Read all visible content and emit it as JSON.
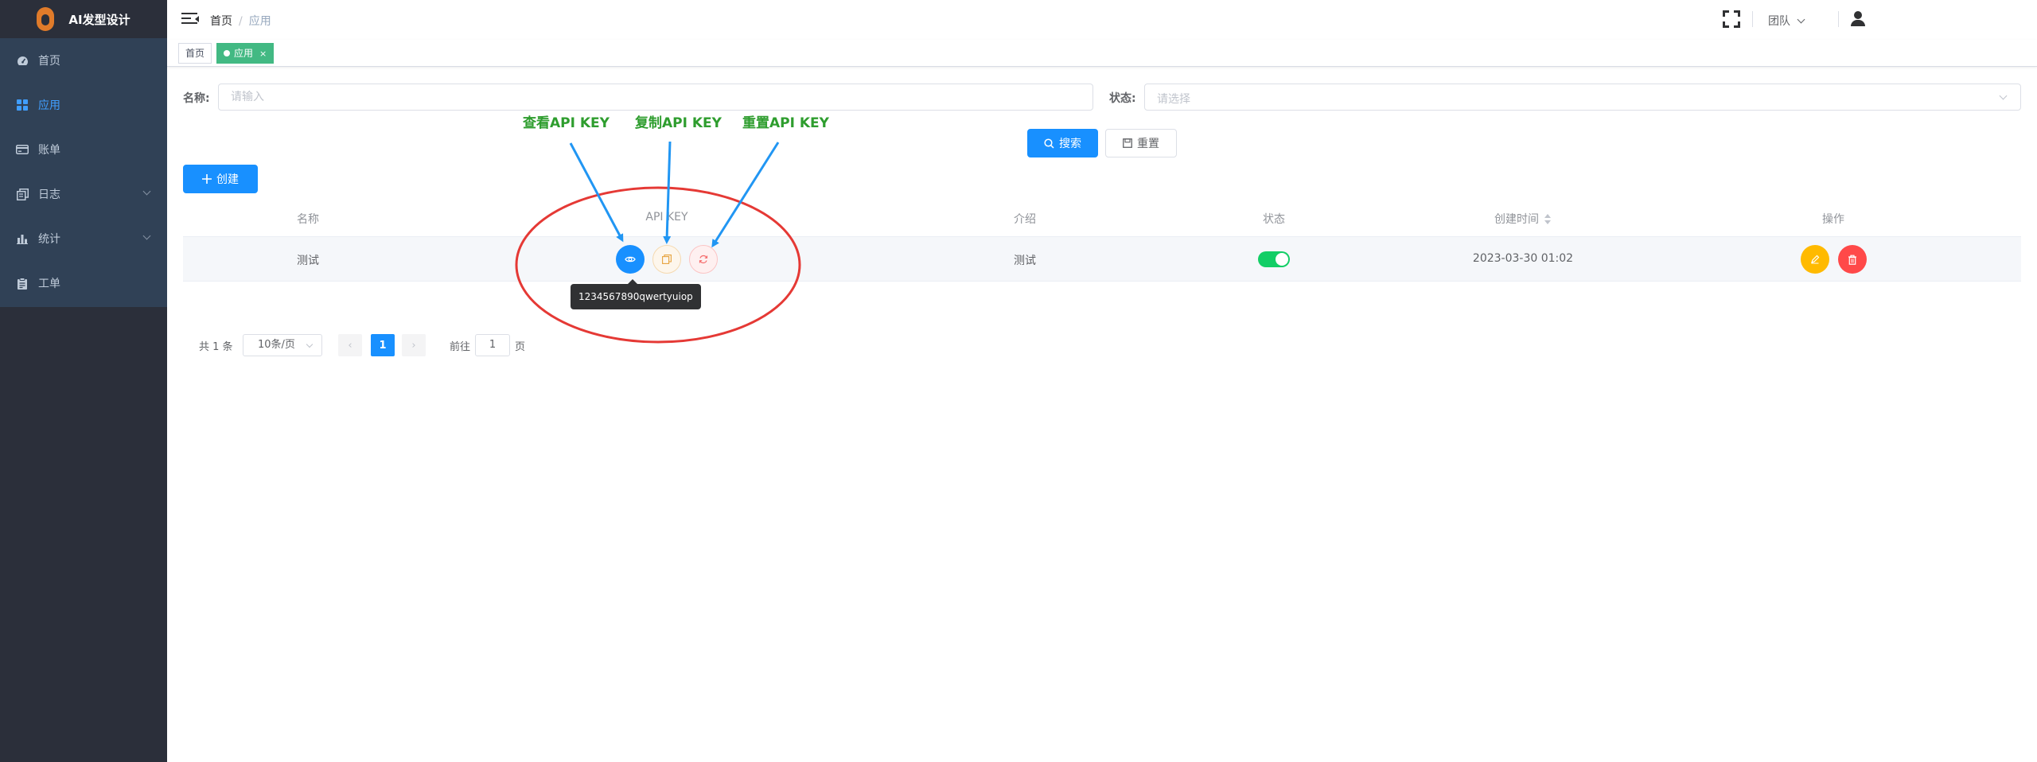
{
  "app": {
    "title": "AI发型设计"
  },
  "sidebar": {
    "items": [
      {
        "label": "首页",
        "icon": "dashboard-icon",
        "active": false,
        "has_children": false
      },
      {
        "label": "应用",
        "icon": "apps-grid-icon",
        "active": true,
        "has_children": false
      },
      {
        "label": "账单",
        "icon": "credit-card-icon",
        "active": false,
        "has_children": false
      },
      {
        "label": "日志",
        "icon": "log-copy-icon",
        "active": false,
        "has_children": true
      },
      {
        "label": "统计",
        "icon": "bar-chart-icon",
        "active": false,
        "has_children": true
      },
      {
        "label": "工单",
        "icon": "clipboard-icon",
        "active": false,
        "has_children": false
      }
    ]
  },
  "header": {
    "breadcrumb": {
      "home": "首页",
      "separator": "/",
      "current": "应用"
    },
    "team_label": "团队"
  },
  "tags": [
    {
      "label": "首页",
      "active": false
    },
    {
      "label": "应用",
      "active": true,
      "close": "×"
    }
  ],
  "search": {
    "name_label": "名称:",
    "name_placeholder": "请输入",
    "status_label": "状态:",
    "status_placeholder": "请选择",
    "search_button": "搜索",
    "reset_button": "重置"
  },
  "toolbar": {
    "create_button": "创建"
  },
  "table": {
    "columns": [
      "名称",
      "API KEY",
      "介绍",
      "状态",
      "创建时间",
      "操作"
    ],
    "rows": [
      {
        "name": "测试",
        "intro": "测试",
        "status_enabled": true,
        "created_at": "2023-03-30 01:02"
      }
    ],
    "tooltip": "1234567890qwertyuiop"
  },
  "pagination": {
    "total": "共 1 条",
    "page_size": "10条/页",
    "prev": "‹",
    "current_page": "1",
    "next": "›",
    "goto_label": "前往",
    "goto_value": "1",
    "goto_unit": "页"
  },
  "annotations": {
    "view_key": "查看API KEY",
    "copy_key": "复制API KEY",
    "reset_key": "重置API KEY",
    "arrow_color": "#2196f3",
    "circle_color": "#e53935",
    "text_color": "#2e9d2e"
  },
  "colors": {
    "sidebar_bg": "#2b2f3a",
    "menu_bg": "#304156",
    "primary": "#1890ff",
    "tag_active": "#42b983",
    "switch_on": "#13ce66",
    "warning": "#ffba00",
    "danger": "#ff4949"
  }
}
